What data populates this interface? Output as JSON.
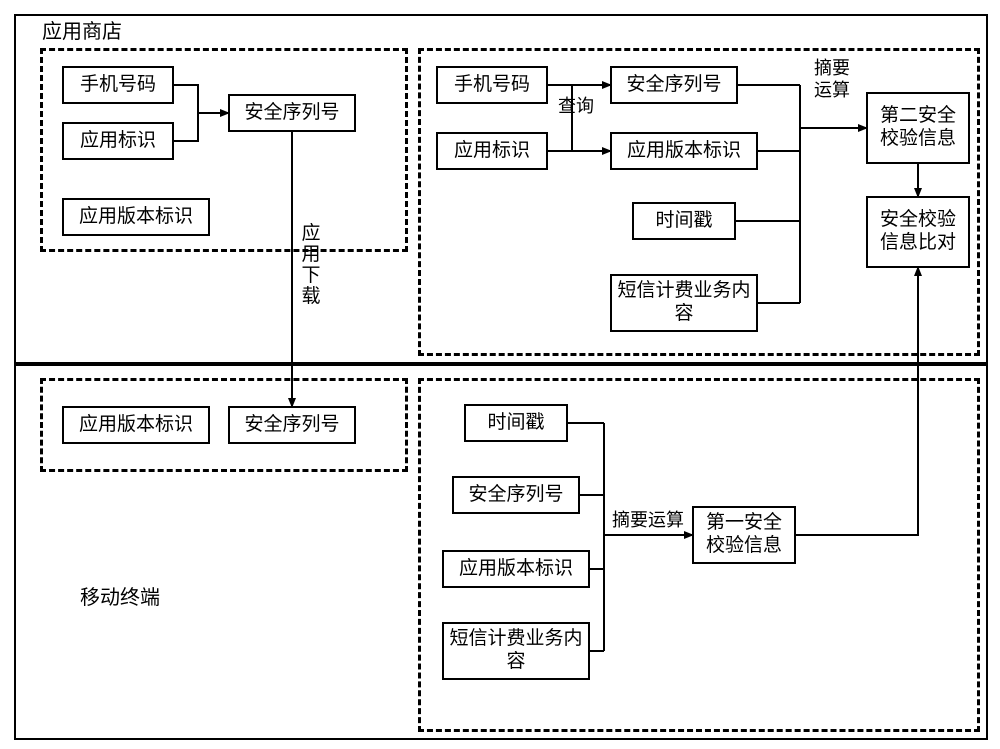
{
  "outer": {
    "app_store_label": "应用商店",
    "mobile_terminal_label": "移动终端"
  },
  "left_top": {
    "phone_number": "手机号码",
    "app_id": "应用标识",
    "security_serial": "安全序列号",
    "app_version_id": "应用版本标识",
    "app_download": "应用下载"
  },
  "right_top": {
    "phone_number": "手机号码",
    "app_id": "应用标识",
    "query": "查询",
    "security_serial": "安全序列号",
    "app_version_id": "应用版本标识",
    "timestamp": "时间戳",
    "sms_billing_content": "短信计费业务内容",
    "digest_op": "摘要运算",
    "second_check": "第二安全校验信息",
    "compare": "安全校验信息比对"
  },
  "left_bottom": {
    "app_version_id": "应用版本标识",
    "security_serial": "安全序列号"
  },
  "right_bottom": {
    "timestamp": "时间戳",
    "security_serial": "安全序列号",
    "app_version_id": "应用版本标识",
    "sms_billing_content": "短信计费业务内容",
    "digest_op": "摘要运算",
    "first_check": "第一安全校验信息"
  }
}
